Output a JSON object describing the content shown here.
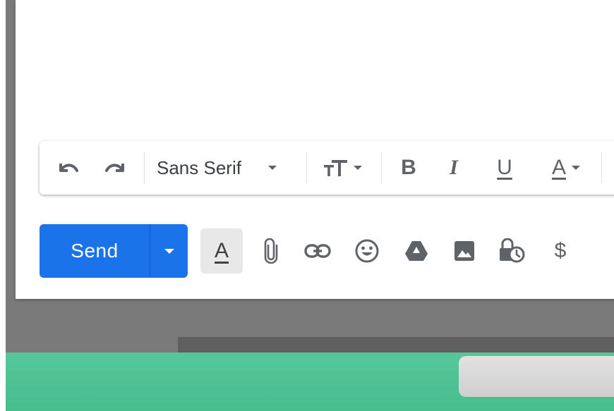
{
  "format_toolbar": {
    "undo_icon": "undo-icon",
    "redo_icon": "redo-icon",
    "font_name": "Sans Serif",
    "font_size_icon": "text-size-icon",
    "bold_label": "B",
    "italic_label": "I",
    "underline_label": "U",
    "text_color_label": "A"
  },
  "bottom_toolbar": {
    "send_label": "Send",
    "formatting_label": "A",
    "icons": [
      "attach-icon",
      "link-icon",
      "emoji-icon",
      "drive-icon",
      "photo-icon",
      "confidential-icon",
      "money-icon"
    ],
    "money_label": "$"
  },
  "colors": {
    "send_blue": "#1a73e8",
    "icon_gray": "#5f6368",
    "green_band": "#4fc395",
    "backdrop_gray": "#7a7a7a"
  }
}
